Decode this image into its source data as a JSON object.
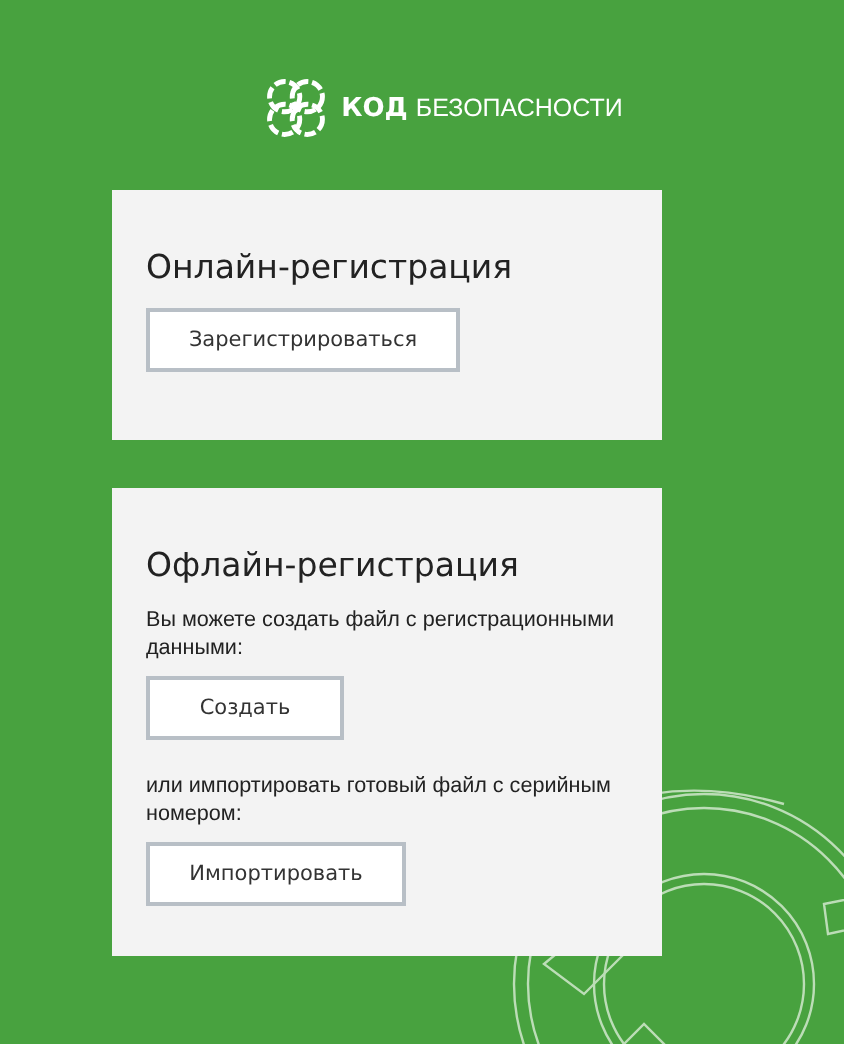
{
  "logo": {
    "brand": "КОД",
    "subtitle": "БЕЗОПАСНОСТИ"
  },
  "sections": [
    {
      "title": "Онлайн-регистрация",
      "items": [
        {
          "kind": "button",
          "text": "Зарегистрироваться"
        }
      ]
    },
    {
      "title": "Офлайн-регистрация",
      "items": [
        {
          "kind": "text",
          "text": "Вы можете создать файл с регистрационными данными:"
        },
        {
          "kind": "button",
          "text": "Создать"
        },
        {
          "kind": "text",
          "text": "или импортировать готовый файл с серийным номером:"
        },
        {
          "kind": "button",
          "text": "Импортировать"
        }
      ]
    }
  ]
}
